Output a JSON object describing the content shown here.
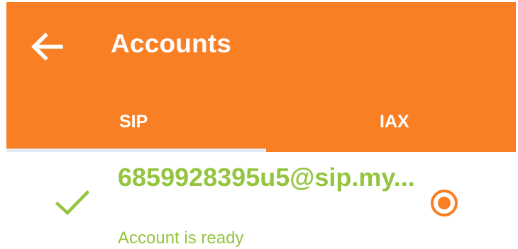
{
  "appbar": {
    "title": "Accounts",
    "back_icon": "arrow-left-icon",
    "background_color": "#f97f24"
  },
  "tabs": [
    {
      "label": "SIP",
      "selected": true
    },
    {
      "label": "IAX",
      "selected": false
    }
  ],
  "accounts": [
    {
      "name": "6859928395u5@sip.my...",
      "status": "Account is ready",
      "status_icon": "check-icon",
      "status_color": "#93c53e",
      "radio_selected": true,
      "radio_color": "#f97f24"
    }
  ]
}
